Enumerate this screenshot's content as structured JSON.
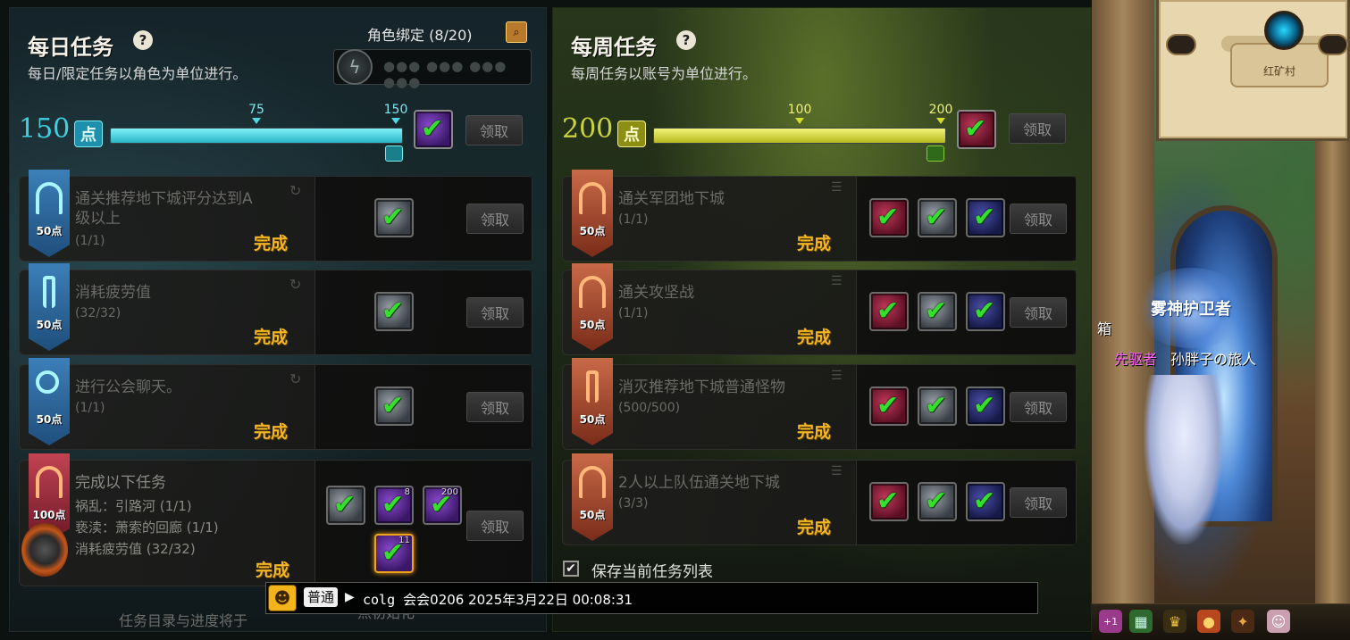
{
  "daily": {
    "title": "每日任务",
    "subtitle": "每日/限定任务以角色为单位进行。",
    "bind_label": "角色绑定 (8/20)",
    "code_placeholder": "●●● ●●● ●●● ●●●",
    "points": "150",
    "points_badge": "点",
    "progress": {
      "current": 150,
      "max": 150,
      "milestones": [
        "75",
        "150"
      ]
    },
    "claim_label": "领取",
    "footer": "任务目录与进度将于",
    "footer_tail": "点初始化",
    "tasks": [
      {
        "name": "通关推荐地下城评分达到A",
        "name2": "级以上",
        "progress": "(1/1)",
        "points": "50点",
        "status": "完成",
        "claim": "领取"
      },
      {
        "name": "消耗疲劳值",
        "progress": "(32/32)",
        "points": "50点",
        "status": "完成",
        "claim": "领取"
      },
      {
        "name": "进行公会聊天。",
        "progress": "(1/1)",
        "points": "50点",
        "status": "完成",
        "claim": "领取"
      },
      {
        "name": "完成以下任务",
        "points": "100点",
        "status": "完成",
        "claim": "领取",
        "sub": [
          "祸乱：引路河 (1/1)",
          "亵渎：萧索的回廊 (1/1)",
          "消耗疲劳值 (32/32)"
        ],
        "reward_qty": [
          "",
          "8",
          "200",
          "11"
        ]
      }
    ]
  },
  "weekly": {
    "title": "每周任务",
    "subtitle": "每周任务以账号为单位进行。",
    "points": "200",
    "points_badge": "点",
    "progress": {
      "current": 200,
      "max": 200,
      "milestones": [
        "100",
        "200"
      ]
    },
    "claim_label": "领取",
    "save_label": "保存当前任务列表",
    "tasks": [
      {
        "name": "通关军团地下城",
        "progress": "(1/1)",
        "points": "50点",
        "status": "完成",
        "claim": "领取"
      },
      {
        "name": "通关攻坚战",
        "progress": "(1/1)",
        "points": "50点",
        "status": "完成",
        "claim": "领取"
      },
      {
        "name": "消灭推荐地下城普通怪物",
        "progress": "(500/500)",
        "points": "50点",
        "status": "完成",
        "claim": "领取"
      },
      {
        "name": "2人以上队伍通关地下城",
        "progress": "(3/3)",
        "points": "50点",
        "status": "完成",
        "claim": "领取"
      }
    ]
  },
  "chat": {
    "channel": "普通",
    "text_prefix": "colg ",
    "text_cjk": "会会0206 2025年3月22日 00:08:31"
  },
  "world": {
    "minimap_label": "红矿村",
    "guild_name": "雾神护卫者",
    "char_title": "先驱者",
    "char_name": "孙胖子の旅人",
    "side_text": "箱",
    "hud_badge": "+1"
  },
  "icons": {
    "help": "help-icon",
    "search": "search-icon",
    "check": "check-icon",
    "refresh": "refresh-icon",
    "menu": "menu-icon"
  },
  "colors": {
    "daily_bar": "#35c8d4",
    "weekly_bar": "#c8cf2a",
    "done": "#f1b526",
    "check": "#35e02c"
  }
}
